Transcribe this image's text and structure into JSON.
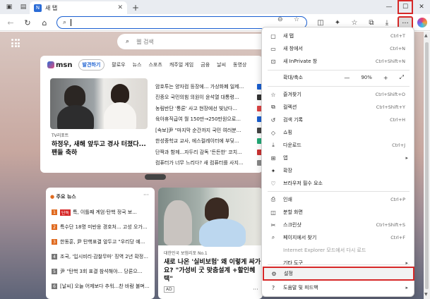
{
  "tab": {
    "favicon": "N",
    "title": "새 탭",
    "close": "✕"
  },
  "window": {
    "minimize": "—",
    "maximize": "☐",
    "close": "✕"
  },
  "address": {
    "value": ""
  },
  "page": {
    "search_placeholder": "웹 검색",
    "msn": {
      "logo": "msn",
      "tabs": [
        "발견하기",
        "팔로우",
        "뉴스",
        "스포츠",
        "캐주얼 게임",
        "금융",
        "날씨",
        "동영상"
      ],
      "source": "TV리포트",
      "headline": "하정우, 새해 앞두고 경사 터졌다...팬들 축하",
      "news": [
        "암호투는 양자컴 등장에... 가상화폐 일제...",
        "진종오 국민의힘 의원이 윤석열 대통령...",
        "농림반단 '통론' 사고 현장에선 빛났다...",
        "육아휴직급여 월 150만→250만원으로...",
        "[속보]尹 \"마지막 순간까지 국민 여러분...",
        "한성중학교 교사, 에스컬레이터에 부딪...",
        "단짝과 함께...자두리 감독 '든든한' 코치...",
        "컴퓨터가 너무 느리다? 새 컴퓨터를 사지..."
      ]
    },
    "top_news": {
      "title": "주요 뉴스",
      "more": "···",
      "items": [
        {
          "num": "1",
          "badge": "단독",
          "text": "특, 이틀째 계엄·탄핵 정국 보..."
        },
        {
          "num": "2",
          "badge": "",
          "text": "특수단 18명 미반응 경호처... 고성 오가..."
        },
        {
          "num": "3",
          "badge": "",
          "text": "한동훈, 尹 탄핵표결 앞두고 \"우리당 예..."
        },
        {
          "num": "4",
          "badge": "",
          "text": "조국, '입시비리·감찰무마' 징역 2년 확정..."
        },
        {
          "num": "5",
          "badge": "",
          "text": "尹 \"탄핵 3회 표결 참석해야... 당론으..."
        },
        {
          "num": "6",
          "badge": "",
          "text": "[날씨] 오늘 어제보다 추워...찬 바람 불며..."
        }
      ]
    },
    "photo_card": {
      "source": "대한민국 보험리포 No.1",
      "headline": "새로 나온 '실비보험' 왜 이렇게 싸가요? \"가성비 굿 맞춤설계 +할인혜택\"",
      "ad": "AD",
      "more": "···"
    }
  },
  "menu": {
    "items": [
      {
        "icon": "▢",
        "label": "새 탭",
        "shortcut": "Ctrl+T"
      },
      {
        "icon": "▭",
        "label": "새 창에서",
        "shortcut": "Ctrl+N"
      },
      {
        "icon": "⊡",
        "label": "새 InPrivate 창",
        "shortcut": "Ctrl+Shift+N"
      },
      {
        "icon": "",
        "label": "확대/축소",
        "zoom_minus": "—",
        "zoom_value": "90%",
        "zoom_plus": "+",
        "fullscreen": "⤢"
      },
      {
        "icon": "☆",
        "label": "즐겨찾기",
        "shortcut": "Ctrl+Shift+O"
      },
      {
        "icon": "⧉",
        "label": "컬렉션",
        "shortcut": "Ctrl+Shift+Y"
      },
      {
        "icon": "↺",
        "label": "검색 기록",
        "shortcut": "Ctrl+H"
      },
      {
        "icon": "◇",
        "label": "쇼핑",
        "shortcut": ""
      },
      {
        "icon": "⤓",
        "label": "다운로드",
        "shortcut": "Ctrl+J"
      },
      {
        "icon": "⊞",
        "label": "앱",
        "arrow": "▸"
      },
      {
        "icon": "✦",
        "label": "확장",
        "shortcut": ""
      },
      {
        "icon": "♡",
        "label": "브라우저 필수 요소",
        "shortcut": ""
      },
      {
        "icon": "⎙",
        "label": "인쇄",
        "shortcut": "Ctrl+P"
      },
      {
        "icon": "◫",
        "label": "분할 화면",
        "shortcut": ""
      },
      {
        "icon": "✂",
        "label": "스크린샷",
        "shortcut": "Ctrl+Shift+S"
      },
      {
        "icon": "⌕",
        "label": "페이지에서 찾기",
        "shortcut": "Ctrl+F"
      },
      {
        "icon": "",
        "label": "Internet Explorer 모드에서 다시 로드",
        "shortcut": ""
      },
      {
        "icon": "",
        "label": "기타 도구",
        "arrow": "▸"
      },
      {
        "icon": "⚙",
        "label": "설정",
        "shortcut": ""
      },
      {
        "icon": "?",
        "label": "도움말 및 피드백",
        "arrow": "▸"
      }
    ]
  }
}
